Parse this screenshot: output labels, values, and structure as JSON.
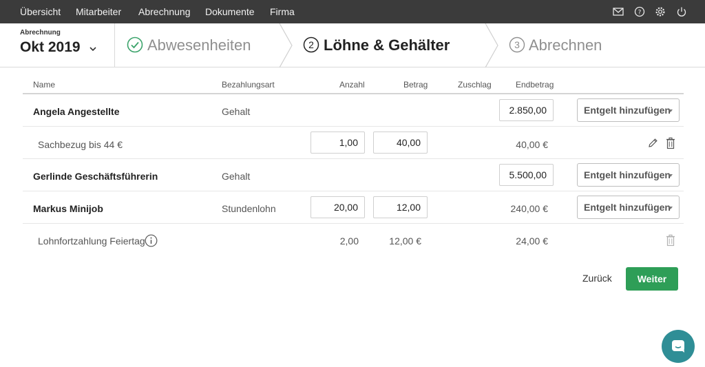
{
  "nav": {
    "items": [
      "Übersicht",
      "Mitarbeiter",
      "Abrechnung",
      "Dokumente",
      "Firma"
    ],
    "icons": [
      "mail-icon",
      "help-icon",
      "gear-icon",
      "power-icon"
    ]
  },
  "period": {
    "label": "Abrechnung",
    "value": "Okt 2019"
  },
  "steps": [
    {
      "number": "",
      "label": "Abwesenheiten",
      "state": "done"
    },
    {
      "number": "2",
      "label": "Löhne & Gehälter",
      "state": "active"
    },
    {
      "number": "3",
      "label": "Abrechnen",
      "state": "upcoming"
    }
  ],
  "table": {
    "headers": {
      "name": "Name",
      "type": "Bezahlungsart",
      "count": "Anzahl",
      "amount": "Betrag",
      "surcharge": "Zuschlag",
      "total": "Endbetrag"
    },
    "rows": [
      {
        "name": "Angela Angestellte",
        "type": "Gehalt",
        "total_input": "2.850,00",
        "action": "Entgelt hinzufügen"
      },
      {
        "name": "Sachbezug bis 44 €",
        "count_input": "1,00",
        "amount_input": "40,00",
        "total": "40,00 €"
      },
      {
        "name": "Gerlinde Geschäftsführerin",
        "type": "Gehalt",
        "total_input": "5.500,00",
        "action": "Entgelt hinzufügen"
      },
      {
        "name": "Markus Minijob",
        "type": "Stundenlohn",
        "count_input": "20,00",
        "amount_input": "12,00",
        "total": "240,00 €",
        "action": "Entgelt hinzufügen"
      },
      {
        "name": "Lohnfortzahlung Feiertag",
        "count": "2,00",
        "amount": "12,00 €",
        "total": "24,00 €"
      }
    ]
  },
  "footer": {
    "back_label": "Zurück",
    "next_label": "Weiter"
  },
  "colors": {
    "topbar": "#3b3b3b",
    "accent_green": "#2e9e57",
    "chat": "#2f8e96",
    "check": "#3aa36a"
  }
}
